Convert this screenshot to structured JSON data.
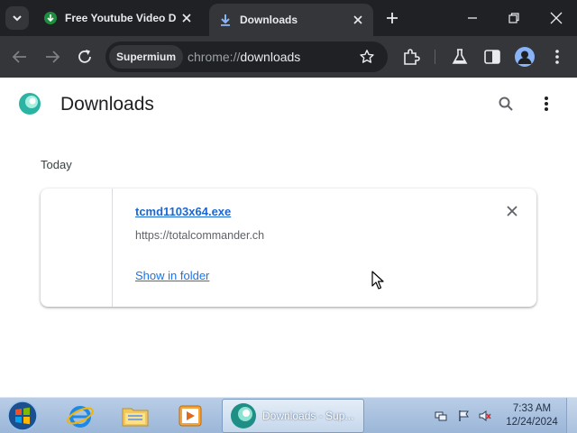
{
  "browser": {
    "tabs": [
      {
        "title": "Free Youtube Video D",
        "active": false,
        "favicon": "green-download-icon"
      },
      {
        "title": "Downloads",
        "active": true,
        "favicon": "download-icon"
      }
    ],
    "toolbar": {
      "chip_label": "Supermium",
      "url_scheme": "chrome://",
      "url_host": "downloads"
    }
  },
  "page": {
    "title": "Downloads",
    "date_header": "Today",
    "downloads": [
      {
        "file_name": "tcmd1103x64.exe",
        "source_url": "https://totalcommander.ch",
        "action_label": "Show in folder"
      }
    ]
  },
  "taskbar": {
    "active_task_label": "Downloads - Sup...",
    "time": "7:33 AM",
    "date": "12/24/2024"
  },
  "colors": {
    "tab_strip": "#202124",
    "toolbar": "#35363a",
    "link": "#1a73e8",
    "taskbar": "#b9cde6"
  }
}
